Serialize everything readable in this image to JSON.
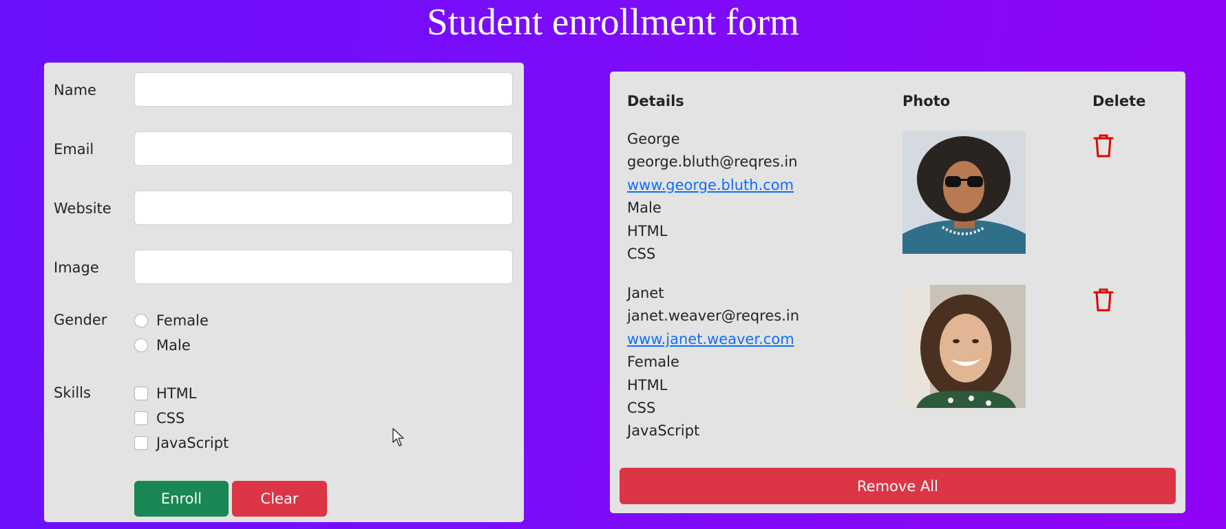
{
  "page": {
    "title": "Student enrollment form"
  },
  "form": {
    "fields": [
      {
        "label": "Name",
        "value": "",
        "placeholder": ""
      },
      {
        "label": "Email",
        "value": "",
        "placeholder": ""
      },
      {
        "label": "Website",
        "value": "",
        "placeholder": ""
      },
      {
        "label": "Image",
        "value": "",
        "placeholder": ""
      }
    ],
    "gender": {
      "label": "Gender",
      "options": [
        "Female",
        "Male"
      ],
      "selected": null
    },
    "skills": {
      "label": "Skills",
      "options": [
        "HTML",
        "CSS",
        "JavaScript"
      ],
      "checked": []
    },
    "buttons": {
      "enroll": "Enroll",
      "clear": "Clear"
    }
  },
  "table": {
    "headers": {
      "details": "Details",
      "photo": "Photo",
      "delete": "Delete"
    },
    "entries": [
      {
        "name": "George",
        "email": "george.bluth@reqres.in",
        "website": "www.george.bluth.com",
        "gender": "Male",
        "skills": [
          "HTML",
          "CSS"
        ],
        "photo": "man-with-sunglasses-photo"
      },
      {
        "name": "Janet",
        "email": "janet.weaver@reqres.in",
        "website": "www.janet.weaver.com",
        "gender": "Female",
        "skills": [
          "HTML",
          "CSS",
          "JavaScript"
        ],
        "photo": "smiling-woman-photo"
      }
    ],
    "delete_icon": "trash-icon",
    "remove_all": "Remove All"
  },
  "colors": {
    "background_start": "#6a10fb",
    "background_end": "#9103f5",
    "card": "#e3e3e3",
    "enroll": "#198754",
    "danger": "#dc3545",
    "link": "#0d6efd"
  }
}
